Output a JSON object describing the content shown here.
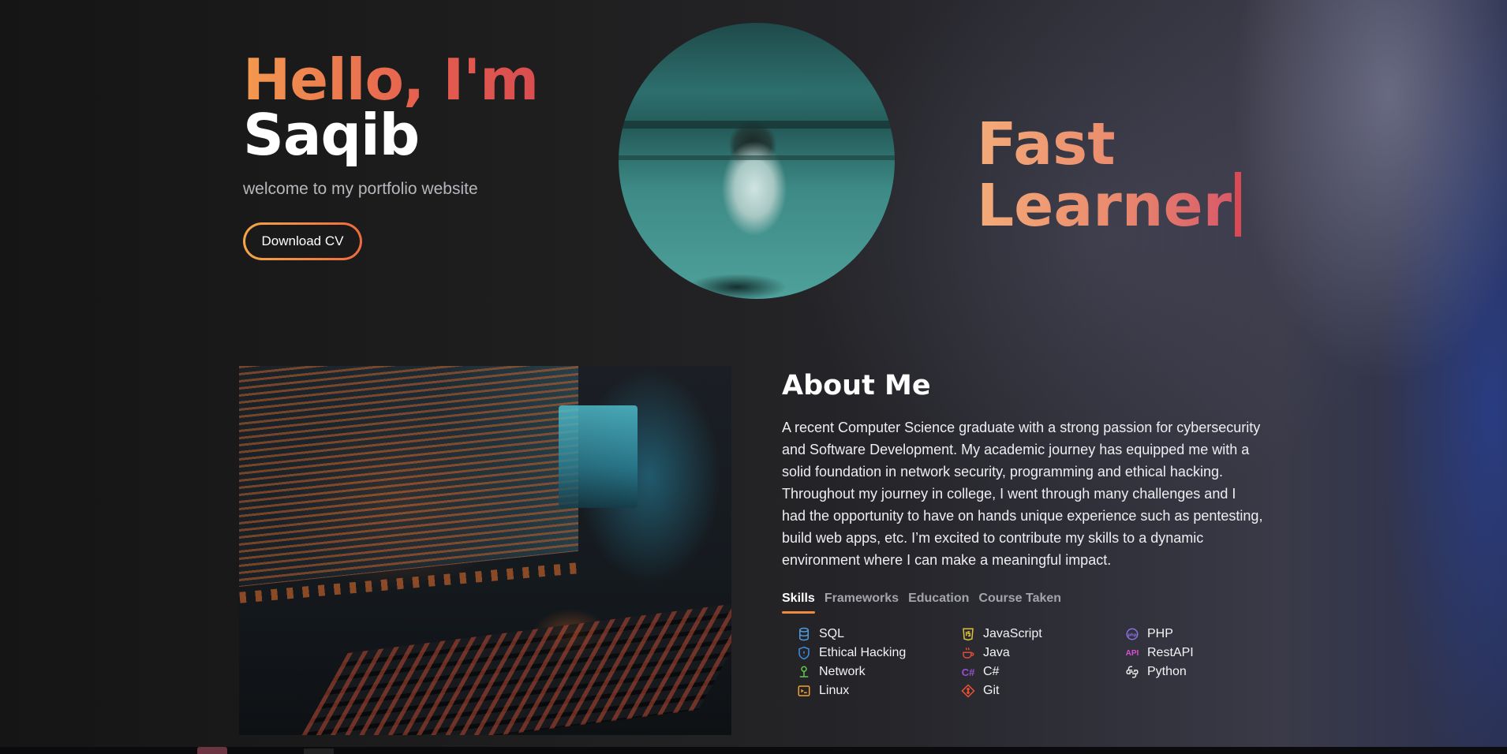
{
  "hero": {
    "greeting": "Hello, I'm",
    "name": "Saqib",
    "subtitle": "welcome to my portfolio website",
    "cv_button": "Download CV",
    "tagline_line1": "Fast",
    "tagline_line2": "Learner"
  },
  "about": {
    "title": "About Me",
    "body": "A recent Computer Science graduate with a strong passion for cybersecurity and Software Development. My academic journey has equipped me with a solid foundation in network security, programming and ethical hacking. Throughout my journey in college, I went through many challenges and I had the opportunity to have on hands unique experience such as pentesting, build web apps, etc. I’m excited to contribute my skills to a dynamic environment where I can make a meaningful impact.",
    "tabs": [
      "Skills",
      "Frameworks",
      "Education",
      "Course Taken"
    ],
    "active_tab": "Skills",
    "skills": [
      {
        "label": "SQL",
        "icon": "database-icon",
        "color": "#4f9be0"
      },
      {
        "label": "JavaScript",
        "icon": "js-icon",
        "color": "#d9c23a"
      },
      {
        "label": "PHP",
        "icon": "php-icon",
        "color": "#8c6fe0"
      },
      {
        "label": "Ethical Hacking",
        "icon": "shield-icon",
        "color": "#3f8fe0"
      },
      {
        "label": "Java",
        "icon": "java-cup-icon",
        "color": "#e04a3a"
      },
      {
        "label": "RestAPI",
        "icon": "api-icon",
        "color": "#d94fd0"
      },
      {
        "label": "Network",
        "icon": "network-icon",
        "color": "#5fc94a"
      },
      {
        "label": "C#",
        "icon": "csharp-icon",
        "color": "#9a4fd0"
      },
      {
        "label": "Python",
        "icon": "python-icon",
        "color": "#e6e6e6"
      },
      {
        "label": "Linux",
        "icon": "terminal-icon",
        "color": "#f0a030"
      },
      {
        "label": "Git",
        "icon": "git-icon",
        "color": "#f05133"
      }
    ]
  },
  "colors": {
    "accent_orange": "#f39a4f",
    "accent_red": "#d94d4f",
    "tab_underline": "#f08a3c"
  }
}
